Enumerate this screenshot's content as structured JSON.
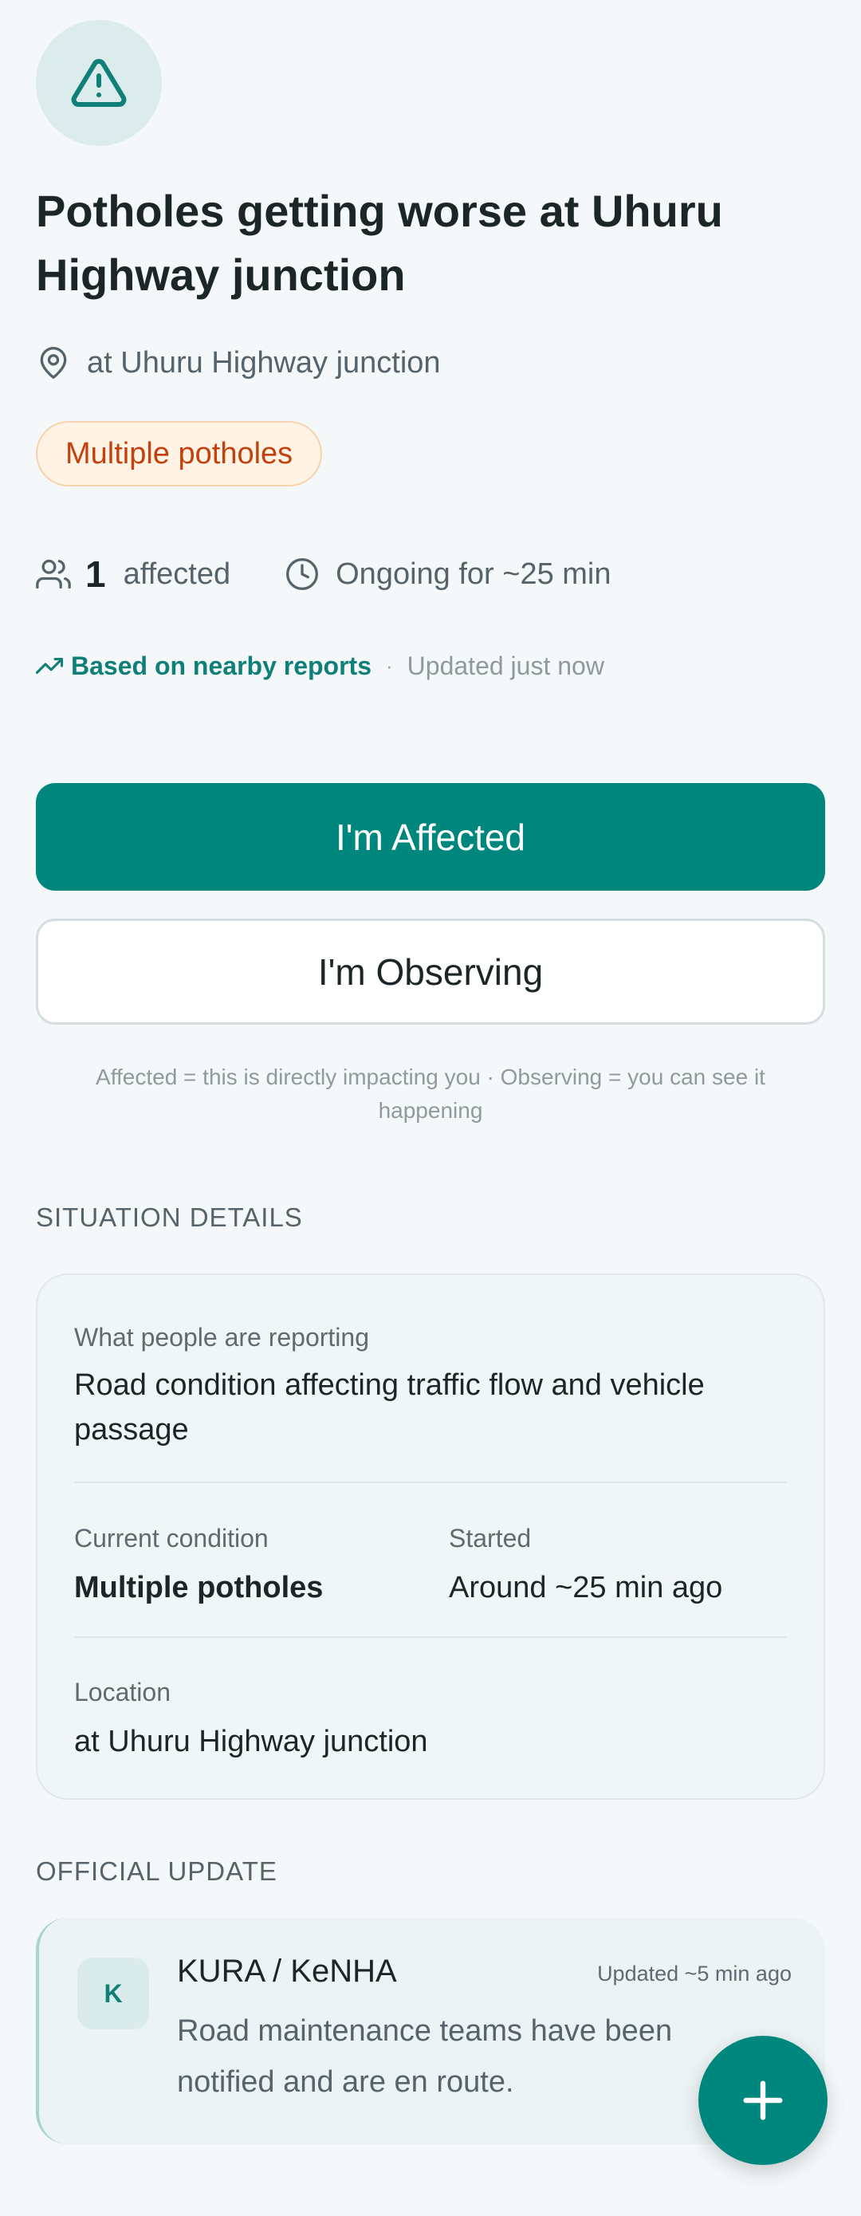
{
  "incident": {
    "title": "Potholes getting worse at Uhuru Highway junction",
    "location": "at Uhuru Highway junction",
    "badge": "Multiple potholes",
    "affected_count": "1",
    "affected_label": "affected",
    "duration": "Ongoing for ~25 min",
    "source": "Based on nearby reports",
    "separator": "·",
    "updated": "Updated just now",
    "hero_icon": "warning-triangle-icon",
    "accent_color": "#00877d"
  },
  "actions": {
    "affected_label": "I'm Affected",
    "observing_label": "I'm Observing",
    "hint": "Affected = this is directly impacting you · Observing = you can see it happening"
  },
  "details": {
    "section_title": "SITUATION DETAILS",
    "reporting_label": "What people are reporting",
    "reporting_value": "Road condition affecting traffic flow and vehicle passage",
    "condition_label": "Current condition",
    "condition_value": "Multiple potholes",
    "started_label": "Started",
    "started_value": "Around ~25 min ago",
    "location_label": "Location",
    "location_value": "at Uhuru Highway junction"
  },
  "official": {
    "section_title": "OFFICIAL UPDATE",
    "avatar_letter": "K",
    "org": "KURA / KeNHA",
    "updated": "Updated ~5 min ago",
    "message": "Road maintenance teams have been notified and are en route."
  },
  "fab": {
    "icon": "plus-icon"
  }
}
